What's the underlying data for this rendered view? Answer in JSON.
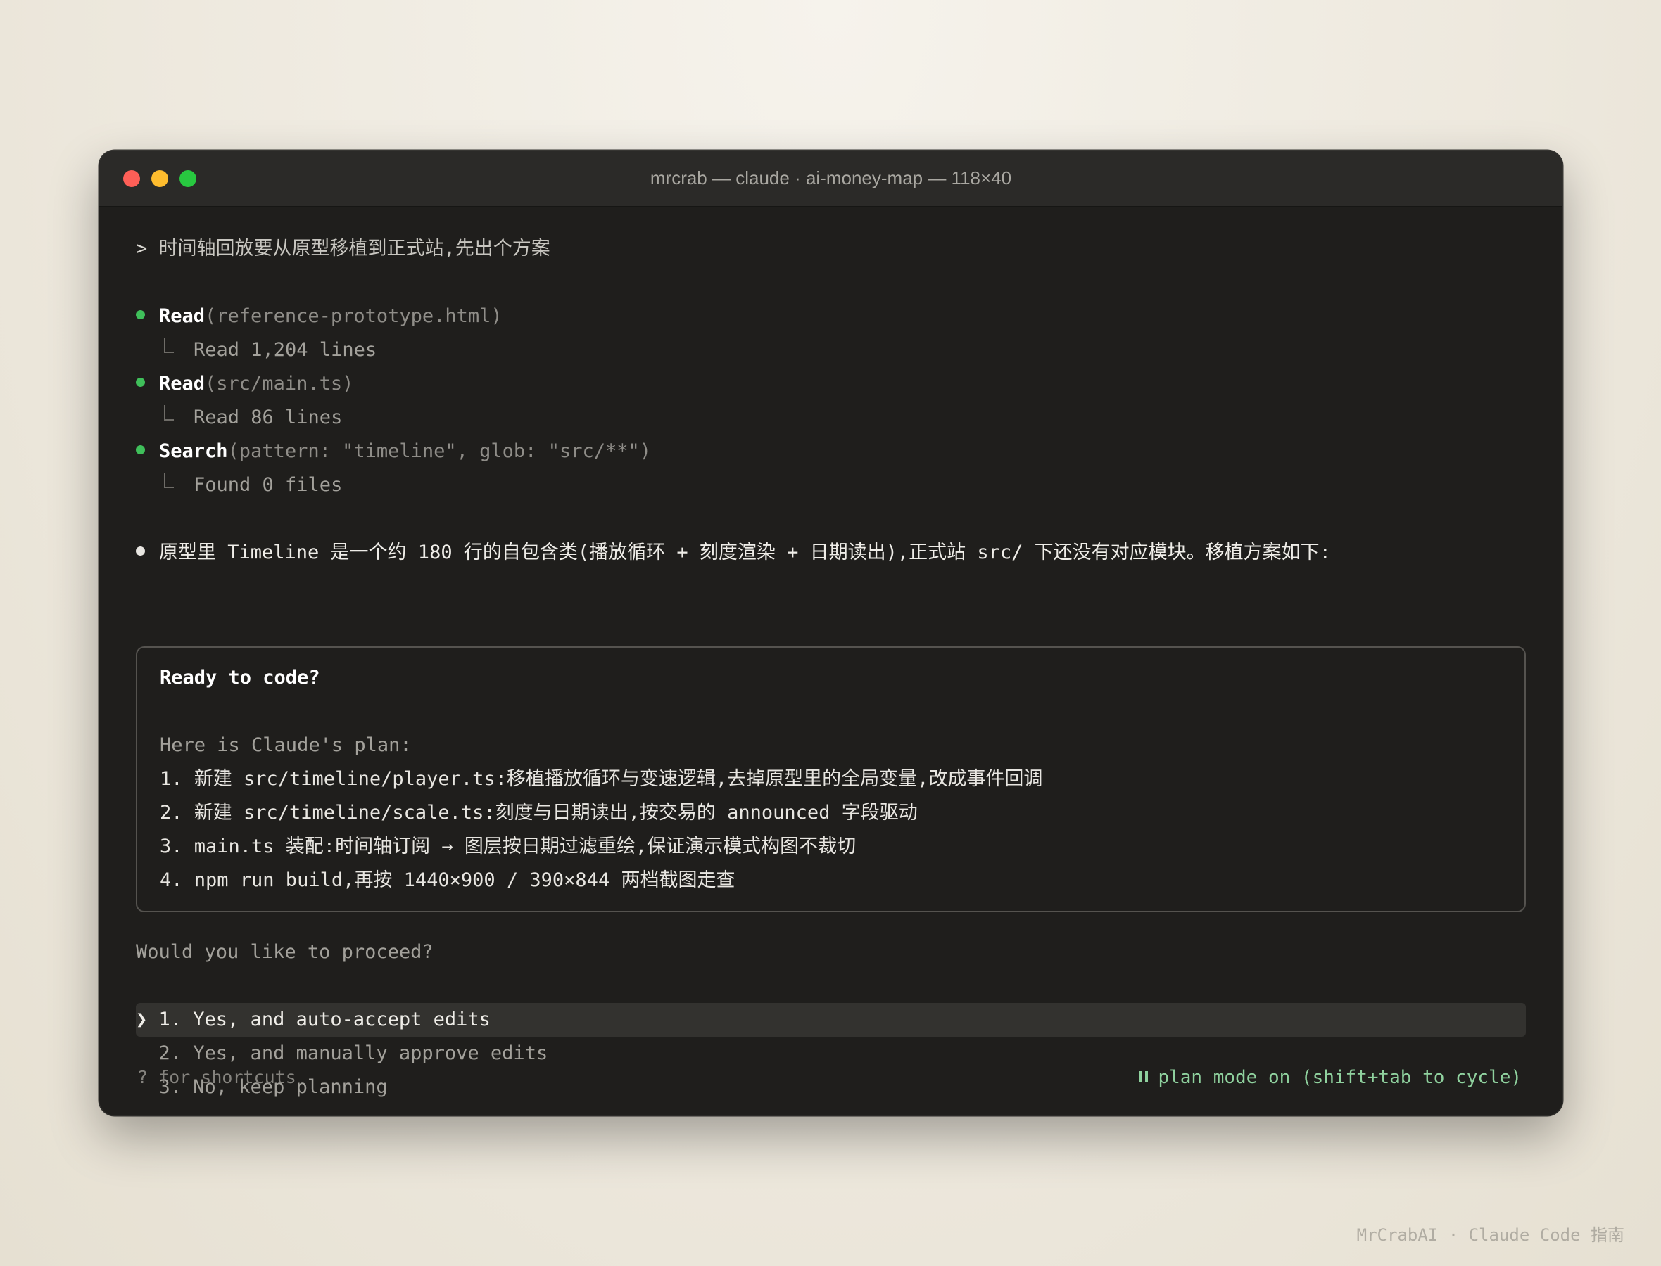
{
  "window": {
    "title": "mrcrab — claude · ai-money-map — 118×40"
  },
  "prompt": {
    "symbol": ">",
    "text": "时间轴回放要从原型移植到正式站,先出个方案"
  },
  "tool_calls": [
    {
      "tool": "Read",
      "args": "(reference-prototype.html)",
      "result": "Read 1,204 lines"
    },
    {
      "tool": "Read",
      "args": "(src/main.ts)",
      "result": "Read 86 lines"
    },
    {
      "tool": "Search",
      "args": "(pattern: \"timeline\", glob: \"src/**\")",
      "result": "Found 0 files"
    }
  ],
  "assistant_message": "原型里 Timeline 是一个约 180 行的自包含类(播放循环 + 刻度渲染 + 日期读出),正式站 src/ 下还没有对应模块。移植方案如下:",
  "plan": {
    "title": "Ready to code?",
    "intro": "Here is Claude's plan:",
    "steps": [
      "1. 新建 src/timeline/player.ts:移植播放循环与变速逻辑,去掉原型里的全局变量,改成事件回调",
      "2. 新建 src/timeline/scale.ts:刻度与日期读出,按交易的 announced 字段驱动",
      "3. main.ts 装配:时间轴订阅 → 图层按日期过滤重绘,保证演示模式构图不裁切",
      "4. npm run build,再按 1440×900 / 390×844 两档截图走查"
    ]
  },
  "question": "Would you like to proceed?",
  "options": {
    "caret": "❯",
    "items": [
      "1. Yes, and auto-accept edits",
      "2. Yes, and manually approve edits",
      "3. No, keep planning"
    ],
    "selected_index": 0
  },
  "footer": {
    "shortcuts_hint": "? for shortcuts",
    "mode_status": "plan mode on (shift+tab to cycle)"
  },
  "watermark": "MrCrabAI · Claude Code 指南",
  "colors": {
    "terminal_bg": "#1f1e1c",
    "titlebar_bg": "#2b2a28",
    "success_dot": "#3fbf5a",
    "plan_mode_green": "#8fd19e",
    "close": "#fe5f57",
    "minimize": "#febc2e",
    "zoom": "#28c840"
  }
}
